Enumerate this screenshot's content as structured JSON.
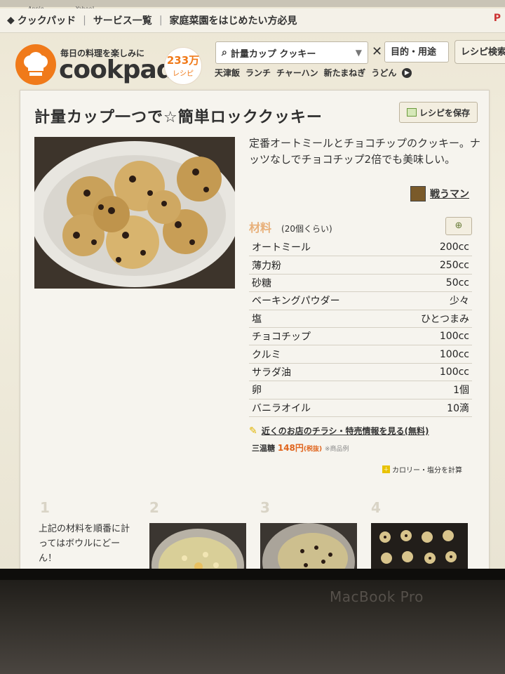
{
  "os_strip": {
    "items": [
      "Apple",
      "Yahoo!"
    ]
  },
  "breadcrumb": {
    "items": [
      "クックパッド",
      "サービス一覧",
      "家庭菜園をはじめたい方必見"
    ],
    "pin": "P"
  },
  "header": {
    "tagline": "毎日の料理を楽しみに",
    "logo": "cookpad",
    "badge_number": "233万",
    "badge_unit": "レシピ",
    "search_value": "計量カップ クッキー",
    "purpose_label": "目的・用途",
    "search_button": "レシピ検索",
    "keywords": [
      "天津飯",
      "ランチ",
      "チャーハン",
      "新たまねぎ",
      "うどん"
    ]
  },
  "recipe": {
    "title": "計量カップ一つで☆簡単ロッククッキー",
    "save_label": "レシピを保存",
    "description": "定番オートミールとチョコチップのクッキー。ナッツなしでチョコチップ2倍でも美味しい。",
    "author": "戦うマン",
    "ingredients_heading": "材料",
    "servings": "(20個くらい)",
    "ingredients": [
      {
        "name": "オートミール",
        "qty": "200cc"
      },
      {
        "name": "薄力粉",
        "qty": "250cc"
      },
      {
        "name": "砂糖",
        "qty": "50cc"
      },
      {
        "name": "ベーキングパウダー",
        "qty": "少々"
      },
      {
        "name": "塩",
        "qty": "ひとつまみ"
      },
      {
        "name": "チョコチップ",
        "qty": "100cc"
      },
      {
        "name": "クルミ",
        "qty": "100cc"
      },
      {
        "name": "サラダ油",
        "qty": "100cc"
      },
      {
        "name": "卵",
        "qty": "1個"
      },
      {
        "name": "バニラオイル",
        "qty": "10滴"
      }
    ],
    "flyer_link": "近くのお店のチラシ・特売情報を見る(無料)",
    "sugar_name": "三温糖",
    "sugar_price": "148円",
    "sugar_tax": "(税抜)",
    "sugar_note": "※商品例",
    "calorie_link": "カロリー・塩分を計算"
  },
  "steps": {
    "numbers": [
      "1",
      "2",
      "3",
      "4"
    ],
    "step1_text": "上記の材料を順番に計ってはボウルにどーん！"
  },
  "device_label": "MacBook Pro",
  "colors": {
    "brand": "#f07a1a",
    "price": "#e0641c",
    "heading": "#e8b07a"
  }
}
